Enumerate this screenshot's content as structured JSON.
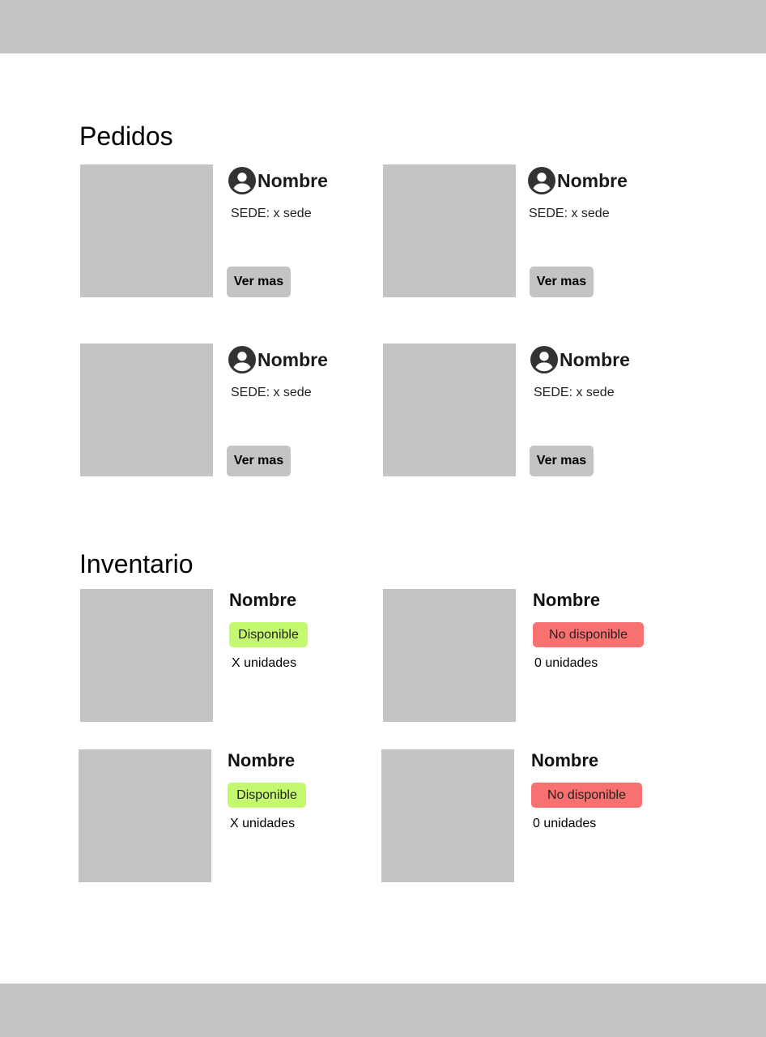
{
  "colors": {
    "placeholder_gray": "#c4c4c4",
    "available_green": "#c4f96f",
    "unavailable_red": "#f87171",
    "icon_dark": "#333333"
  },
  "pedidos": {
    "title": "Pedidos",
    "items": [
      {
        "name": "Nombre",
        "sede": "SEDE: x sede",
        "button": "Ver mas",
        "icon": "user-circle-icon"
      },
      {
        "name": "Nombre",
        "sede": "SEDE: x sede",
        "button": "Ver mas",
        "icon": "user-circle-icon"
      },
      {
        "name": "Nombre",
        "sede": "SEDE: x sede",
        "button": "Ver mas",
        "icon": "user-circle-icon"
      },
      {
        "name": "Nombre",
        "sede": "SEDE: x sede",
        "button": "Ver mas",
        "icon": "user-circle-icon"
      }
    ]
  },
  "inventario": {
    "title": "Inventario",
    "items": [
      {
        "name": "Nombre",
        "status": "Disponible",
        "units": "X unidades"
      },
      {
        "name": "Nombre",
        "status": "No disponible",
        "units": "0 unidades"
      },
      {
        "name": "Nombre",
        "status": "Disponible",
        "units": "X unidades"
      },
      {
        "name": "Nombre",
        "status": "No disponible",
        "units": "0 unidades"
      }
    ]
  }
}
